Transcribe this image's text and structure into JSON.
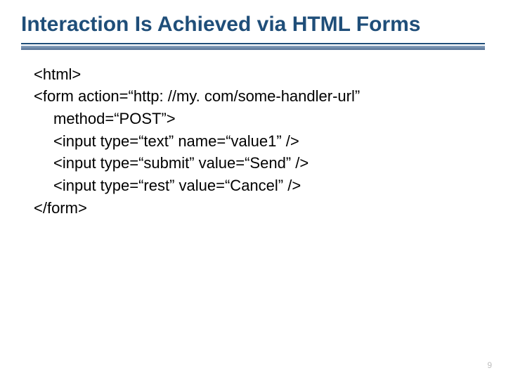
{
  "title": "Interaction Is Achieved via HTML Forms",
  "code": {
    "l1": "<html>",
    "l2a": "<form action=“http: //my. com/some-handler-url”",
    "l2b": "method=“POST”>",
    "l3": "<input type=“text” name=“value1” />",
    "l4": "<input type=“submit” value=“Send” />",
    "l5": "<input type=“rest” value=“Cancel” />",
    "l6": "</form>"
  },
  "slideNumber": "9"
}
